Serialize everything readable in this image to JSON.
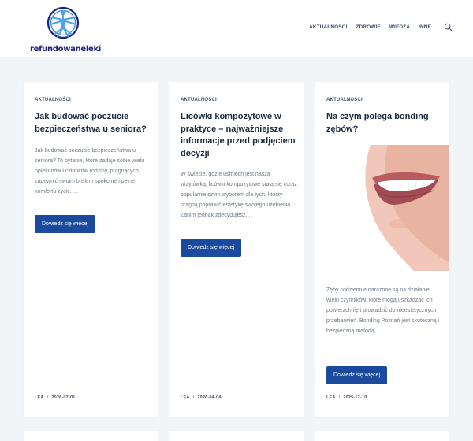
{
  "site": {
    "logo_text": "refundowaneleki"
  },
  "nav": {
    "items": [
      "AKTUALNOŚCI",
      "ZDROWIE",
      "WIEDZA",
      "INNE"
    ],
    "search_icon": "search-icon"
  },
  "colors": {
    "accent": "#1a4a9e",
    "heading": "#192a3d",
    "background": "#f2f5f7"
  },
  "posts": [
    {
      "category": "AKTUALNOŚCI",
      "title": "Jak budować poczucie bezpieczeństwa u seniora?",
      "excerpt": "Jak budować poczucie bezpieczeństwa u seniora? To pytanie, które zadaje sobie wielu opiekunów i członków rodziny, pragnących zapewnić swoim bliskim spokojne i pełne komfortu życie. ...",
      "button": "Dowiedz się więcej",
      "author": "LEA",
      "date": "2026-07-01"
    },
    {
      "category": "AKTUALNOŚCI",
      "title": "Licówki kompozytowe w praktyce – najważniejsze informacje przed podjęciem decyzji",
      "excerpt": "W świecie, gdzie uśmiech jest naszą wizytówką, licówki kompozytowe stają się coraz popularniejszym wyborem dla tych, którzy pragną poprawić estetykę swojego uzębienia. Zanim jednak zdecydujesz...",
      "button": "Dowiedz się więcej",
      "author": "LEA",
      "date": "2026-04-04"
    },
    {
      "category": "AKTUALNOŚCI",
      "title": "Na czym polega bonding zębów?",
      "excerpt": "Zęby codziennie narażone są na działanie wielu czynników, które mogą uszkadzać ich powierzchnię i prowadzić do nieestetycznych przebarwień. Bonding Poznań jest skuteczną i bezpieczną metodą, ...",
      "button": "Dowiedz się więcej",
      "author": "LEA",
      "date": "2025-12-10"
    }
  ]
}
